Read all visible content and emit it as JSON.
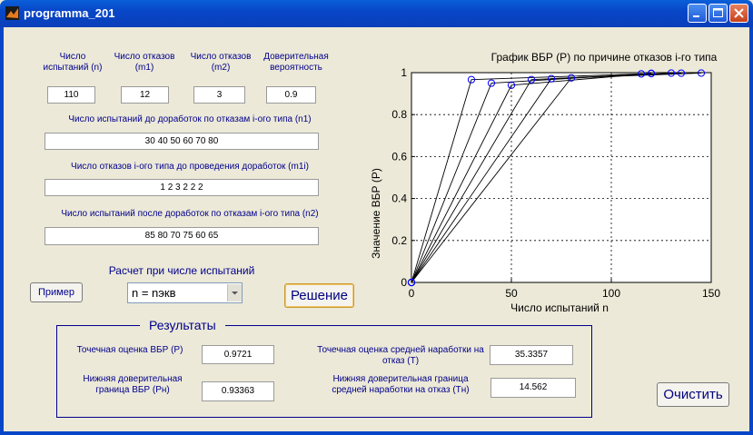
{
  "window": {
    "title": "programma_201"
  },
  "inputs": {
    "n_label": "Число испытаний (n)",
    "n_value": "110",
    "m1_label": "Число отказов (m1)",
    "m1_value": "12",
    "m2_label": "Число отказов (m2)",
    "m2_value": "3",
    "conf_label": "Доверительная вероятность",
    "conf_value": "0.9",
    "n1_label": "Число испытаний до доработок по отказам i-ого типа  (n1)",
    "n1_value": "30  40  50  60  70  80",
    "m1i_label": "Число отказов i-ого типа до проведения доработок (m1i)",
    "m1i_value": "1  2  3  2  2  2",
    "n2_label": "Число испытаний  после доработок по отказам i-ого типа (n2)",
    "n2_value": "85  80  70  75  60  65"
  },
  "calc": {
    "label": "Расчет при числе испытаний",
    "selected": "n = nэкв",
    "example_button": "Пример",
    "solve_button": "Решение",
    "clear_button": "Очистить"
  },
  "results": {
    "title": "Результаты",
    "p_label": "Точечная оценка ВБР (P)",
    "p_value": "0.9721",
    "pn_label": "Нижняя доверительная граница ВБР (Pн)",
    "pn_value": "0.93363",
    "t_label": "Точечная оценка средней наработки на отказ  (T)",
    "t_value": "35.3357",
    "tn_label": "Нижняя доверительная граница средней наработки на отказ  (Tн)",
    "tn_value": "14.562"
  },
  "chart_data": {
    "type": "line",
    "title": "График ВБР (P) по причине отказов i-го типа",
    "xlabel": "Число испытаний n",
    "ylabel": "Значение ВБР (P)",
    "xlim": [
      0,
      150
    ],
    "ylim": [
      0,
      1
    ],
    "xticks": [
      0,
      50,
      100,
      150
    ],
    "yticks": [
      0,
      0.2,
      0.4,
      0.6,
      0.8,
      1
    ],
    "grid": true,
    "series": [
      {
        "x": [
          0,
          30,
          115
        ],
        "y": [
          0,
          0.9667,
          0.9942
        ]
      },
      {
        "x": [
          0,
          40,
          120
        ],
        "y": [
          0,
          0.95,
          0.9958
        ]
      },
      {
        "x": [
          0,
          50,
          120
        ],
        "y": [
          0,
          0.94,
          0.9967
        ]
      },
      {
        "x": [
          0,
          60,
          135
        ],
        "y": [
          0,
          0.9667,
          0.9975
        ]
      },
      {
        "x": [
          0,
          70,
          130
        ],
        "y": [
          0,
          0.9714,
          0.9977
        ]
      },
      {
        "x": [
          0,
          80,
          145
        ],
        "y": [
          0,
          0.975,
          0.998
        ]
      }
    ]
  }
}
